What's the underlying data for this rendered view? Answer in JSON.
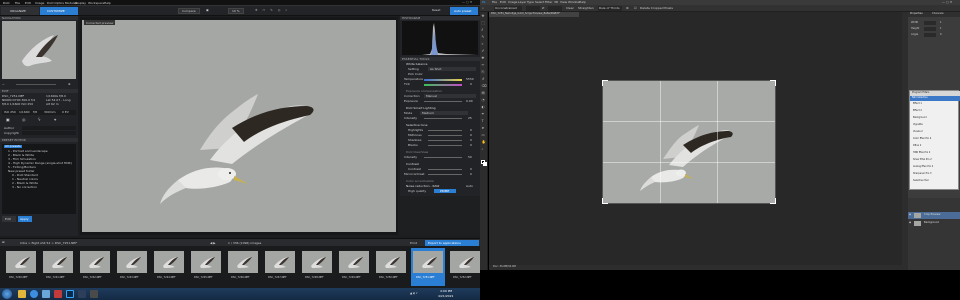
{
  "left_app": {
    "menubar": {
      "title": "DxO",
      "items": [
        "File",
        "Edit",
        "Image",
        "DxO Optics Modules",
        "Display",
        "Workspace",
        "Help"
      ]
    },
    "toolbar": {
      "tab_organize": "ORGANIZE",
      "tab_customize": "CUSTOMIZE",
      "compare_label": "Compare",
      "zoom_value": "10 %",
      "reset_label": "Reset",
      "auto_preset_label": "Auto preset"
    },
    "left_panel": {
      "navigation_title": "NAVIGATION",
      "exif_title": "EXIF",
      "exif_rows": [
        [
          "DSC_7251.NEF",
          "1/1600s  f/8.0"
        ],
        [
          "NIKON D700  300.0 f/4",
          "Lat 52.07 - Long"
        ],
        [
          "f/8.0  1/1600  ISO 250",
          "Alt 62 m"
        ]
      ],
      "exif_stats": [
        "ISO 250",
        "1/1600",
        "f/8",
        "300mm",
        "0 EV"
      ],
      "author_label": "Author",
      "copyright_label": "Copyright",
      "preset_editor_title": "PRESET EDITOR",
      "preset_tree": [
        "All presets",
        "1 - Portrait and Landscape",
        "2 - Black & White",
        "3 - Film Simulation",
        "4 - High Dynamic Range (single-shot HDR)",
        "5 - Tinting/Borders",
        "New preset folder",
        "0 - DxO Standard",
        "1 - Neutral colors",
        "2 - Black & White",
        "3 - No correction"
      ],
      "edit_button": "Edit",
      "apply_button": "Apply"
    },
    "viewer": {
      "label": "Corrected preview"
    },
    "right_panel": {
      "histogram_title": "HISTOGRAM",
      "essential_tools_title": "ESSENTIAL TOOLS",
      "white_balance_title": "White balance",
      "wb_setting_label": "Setting",
      "wb_setting_value": "As Shot",
      "pick_color_label": "Pick Color",
      "temperature_label": "Temperature",
      "temperature_value": "5550",
      "tint_label": "Tint",
      "tint_value": "0",
      "exposure_comp_title": "Exposure compensation",
      "correction_label": "Correction",
      "correction_value": "Manual",
      "exposure_label": "Exposure",
      "exposure_value": "0.00",
      "smart_lighting_title": "DxO Smart Lighting",
      "mode_label": "Mode",
      "mode_value": "Medium",
      "intensity_label": "Intensity",
      "intensity_value": "25",
      "selective_tone_title": "Selective tone",
      "tone_rows": [
        [
          "Highlights",
          "0"
        ],
        [
          "Midtones",
          "0"
        ],
        [
          "Shadows",
          "0"
        ],
        [
          "Blacks",
          "0"
        ]
      ],
      "clearview_title": "DxO ClearView",
      "clearview_intensity_label": "Intensity",
      "clearview_intensity_value": "50",
      "contrast_title": "Contrast",
      "contrast_label": "Contrast",
      "contrast_value": "0",
      "microcontrast_label": "Microcontrast",
      "microcontrast_value": "0",
      "color_accent_title": "Color accentuation",
      "noise_label": "Noise reduction - RAW",
      "noise_value": "Auto",
      "high_quality_label": "High quality",
      "prime_label": "PRIME"
    },
    "filmstrip_bar": {
      "path_text": "Intra > flight shit 52 > DSC_7251.NEF",
      "count_text": "1 / 336 (1096) images",
      "print_button": "Print",
      "export_button": "Export to applications"
    },
    "thumbnails": [
      "DSC_7240.NEF",
      "DSC_7241.NEF",
      "DSC_7242.NEF",
      "DSC_7243.NEF",
      "DSC_7244.NEF",
      "DSC_7245.NEF",
      "DSC_7246.NEF",
      "DSC_7247.NEF",
      "DSC_7248.NEF",
      "DSC_7249.NEF",
      "DSC_7250.NEF",
      "DSC_7251.NEF",
      "DSC_7252.NEF"
    ],
    "selected_thumbnail_index": 11
  },
  "taskbar": {
    "time": "4:09 PM",
    "date": "4/21/2021"
  },
  "right_app": {
    "menubar": [
      "Ps",
      "File",
      "Edit",
      "Image",
      "Layer",
      "Type",
      "Select",
      "Filter",
      "3D",
      "View",
      "Window",
      "Help"
    ],
    "options_bar": {
      "ratio_label": "Unconstrained",
      "width_value": "",
      "height_value": "",
      "clear_label": "Clear",
      "straighten_label": "Straighten",
      "view_label": "Rule of Thirds",
      "delete_cropped_label": "Delete Cropped Pixels"
    },
    "doc_tab": "DSC_7251_NeCollga_G1/U_Scrgs Preview_Ba8e/RGB/8*",
    "status_text": "Doc: 34.0M/34.0M",
    "properties_title": "Properties",
    "channels_title": "Channels",
    "panel_rows": [
      [
        "Width",
        "1"
      ],
      [
        "Height",
        "1"
      ],
      [
        "Angle",
        "0"
      ]
    ],
    "plugin_menu_title": "Program Filters",
    "plugin_sub_title": "Nik Collection",
    "plugin_items": [
      "Effect 1",
      "Effect 2",
      "Background",
      "Vignette",
      "Viveza 2",
      "Color Efex Pro 4",
      "Dfine 2",
      "HDR Efex Pro 2",
      "Silver Efex Pro 2",
      "Analog Efex Pro 2",
      "Sharpener Pro 3",
      "Selective Tool"
    ],
    "layers": [
      {
        "name": "Crop Preview",
        "selected": true
      },
      {
        "name": "Background",
        "selected": false
      }
    ]
  },
  "colors": {
    "dxo_bg": "#1c1d1f",
    "dxo_panel": "#2a2b2e",
    "accent_blue": "#2a7fd4",
    "ps_bg": "#282828",
    "ps_panel": "#3c3c3c",
    "photo_grey": "#a4a6a4"
  }
}
